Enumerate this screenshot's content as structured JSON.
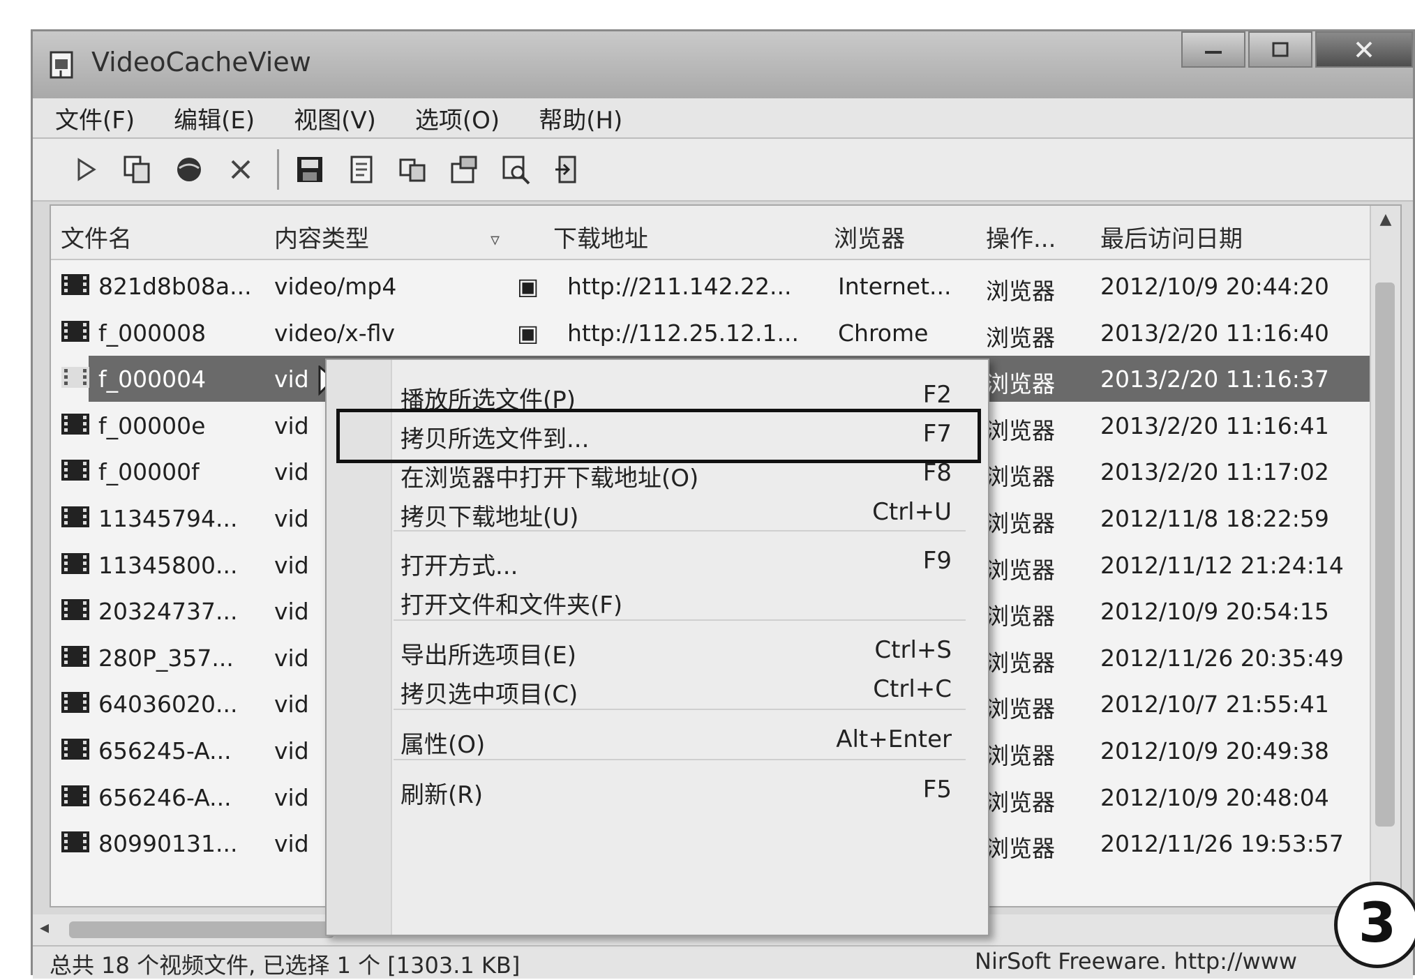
{
  "window": {
    "title": "VideoCacheView",
    "controls": {
      "minimize": "minimize",
      "maximize": "maximize",
      "close": "close"
    }
  },
  "menubar": [
    "文件(F)",
    "编辑(E)",
    "视图(V)",
    "选项(O)",
    "帮助(H)"
  ],
  "toolbar": [
    {
      "icon": "play-icon"
    },
    {
      "icon": "copy-files-icon"
    },
    {
      "icon": "globe-icon"
    },
    {
      "icon": "delete-icon"
    },
    {
      "icon": "save-icon"
    },
    {
      "icon": "report-icon"
    },
    {
      "icon": "copy-icon"
    },
    {
      "icon": "properties-icon"
    },
    {
      "icon": "find-icon"
    },
    {
      "icon": "exit-icon"
    }
  ],
  "columns": [
    "文件名",
    "内容类型",
    "下载地址",
    "浏览器",
    "操作...",
    "最后访问日期"
  ],
  "rows": [
    {
      "name": "821d8b08a...",
      "type": "video/mp4",
      "url": "http://211.142.22...",
      "browser": "Internet...",
      "action": "浏览器",
      "date": "2012/10/9 20:44:20",
      "selected": false
    },
    {
      "name": "f_000008",
      "type": "video/x-flv",
      "url": "http://112.25.12.1...",
      "browser": "Chrome",
      "action": "浏览器",
      "date": "2013/2/20 11:16:40",
      "selected": false
    },
    {
      "name": "f_000004",
      "type": "vid",
      "url": "",
      "browser": "",
      "action": "浏览器",
      "date": "2013/2/20 11:16:37",
      "selected": true
    },
    {
      "name": "f_00000e",
      "type": "vid",
      "url": "",
      "browser": "",
      "action": "浏览器",
      "date": "2013/2/20 11:16:41",
      "selected": false
    },
    {
      "name": "f_00000f",
      "type": "vid",
      "url": "",
      "browser": "",
      "action": "浏览器",
      "date": "2013/2/20 11:17:02",
      "selected": false
    },
    {
      "name": "11345794...",
      "type": "vid",
      "url": "",
      "browser": "",
      "action": "浏览器",
      "date": "2012/11/8 18:22:59",
      "selected": false
    },
    {
      "name": "11345800...",
      "type": "vid",
      "url": "",
      "browser": "",
      "action": "浏览器",
      "date": "2012/11/12 21:24:14",
      "selected": false
    },
    {
      "name": "20324737...",
      "type": "vid",
      "url": "",
      "browser": "",
      "action": "浏览器",
      "date": "2012/10/9 20:54:15",
      "selected": false
    },
    {
      "name": "280P_357...",
      "type": "vid",
      "url": "",
      "browser": "",
      "action": "浏览器",
      "date": "2012/11/26 20:35:49",
      "selected": false
    },
    {
      "name": "64036020...",
      "type": "vid",
      "url": "",
      "browser": "",
      "action": "浏览器",
      "date": "2012/10/7 21:55:41",
      "selected": false
    },
    {
      "name": "656245-A...",
      "type": "vid",
      "url": "",
      "browser": "",
      "action": "浏览器",
      "date": "2012/10/9 20:49:38",
      "selected": false
    },
    {
      "name": "656246-A...",
      "type": "vid",
      "url": "",
      "browser": "",
      "action": "浏览器",
      "date": "2012/10/9 20:48:04",
      "selected": false
    },
    {
      "name": "80990131...",
      "type": "vid",
      "url": "",
      "browser": "",
      "action": "浏览器",
      "date": "2012/11/26 19:53:57",
      "selected": false
    }
  ],
  "context_menu": [
    {
      "label": "播放所选文件(P)",
      "shortcut": "F2",
      "highlighted": false
    },
    {
      "label": "拷贝所选文件到...",
      "shortcut": "F7",
      "highlighted": true
    },
    {
      "label": "在浏览器中打开下载地址(O)",
      "shortcut": "F8",
      "highlighted": false
    },
    {
      "label": "拷贝下载地址(U)",
      "shortcut": "Ctrl+U",
      "highlighted": false
    },
    {
      "label": "打开方式...",
      "shortcut": "F9",
      "highlighted": false
    },
    {
      "label": "打开文件和文件夹(F)",
      "shortcut": "",
      "highlighted": false
    },
    {
      "label": "导出所选项目(E)",
      "shortcut": "Ctrl+S",
      "highlighted": false
    },
    {
      "label": "拷贝选中项目(C)",
      "shortcut": "Ctrl+C",
      "highlighted": false
    },
    {
      "label": "属性(O)",
      "shortcut": "Alt+Enter",
      "highlighted": false
    },
    {
      "label": "刷新(R)",
      "shortcut": "F5",
      "highlighted": false
    }
  ],
  "status": {
    "left": "总共 18 个视频文件, 已选择 1 个 [1303.1 KB]",
    "right": "NirSoft Freeware. http://www"
  },
  "step_badge": "3"
}
